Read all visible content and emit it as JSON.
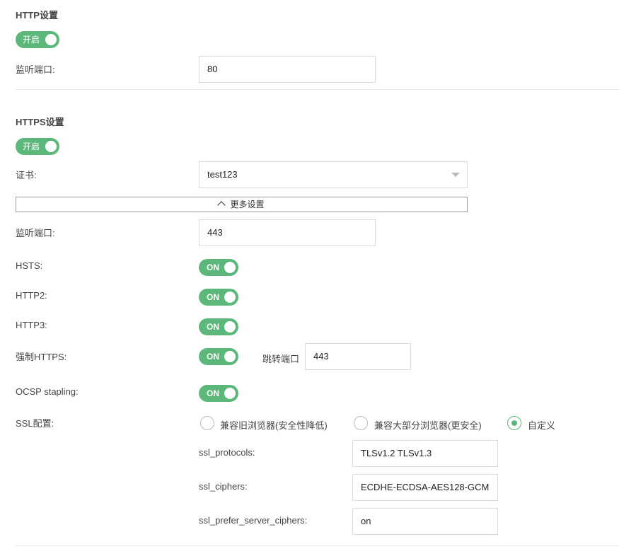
{
  "http": {
    "title": "HTTP设置",
    "toggle_label": "开启",
    "port_label": "监听端口:",
    "port_value": "80"
  },
  "https": {
    "title": "HTTPS设置",
    "toggle_label": "开启",
    "cert_label": "证书:",
    "cert_value": "test123",
    "more_settings": "更多设置",
    "port_label": "监听端口:",
    "port_value": "443",
    "hsts_label": "HSTS:",
    "hsts_value": "ON",
    "http2_label": "HTTP2:",
    "http2_value": "ON",
    "http3_label": "HTTP3:",
    "http3_value": "ON",
    "force_https_label": "强制HTTPS:",
    "force_https_value": "ON",
    "redirect_port_label": "跳转端口",
    "redirect_port_value": "443",
    "ocsp_label": "OCSP stapling:",
    "ocsp_value": "ON",
    "ssl_label": "SSL配置:",
    "ssl_options": [
      {
        "label": "兼容旧浏览器(安全性降低)",
        "checked": false
      },
      {
        "label": "兼容大部分浏览器(更安全)",
        "checked": false
      },
      {
        "label": "自定义",
        "checked": true
      }
    ],
    "ssl_protocols_label": "ssl_protocols:",
    "ssl_protocols_value": "TLSv1.2 TLSv1.3",
    "ssl_ciphers_label": "ssl_ciphers:",
    "ssl_ciphers_value": "ECDHE-ECDSA-AES128-GCM",
    "ssl_prefer_label": "ssl_prefer_server_ciphers:",
    "ssl_prefer_value": "on"
  },
  "colors": {
    "accent": "#5cb87a",
    "border": "#dcdcdc"
  }
}
